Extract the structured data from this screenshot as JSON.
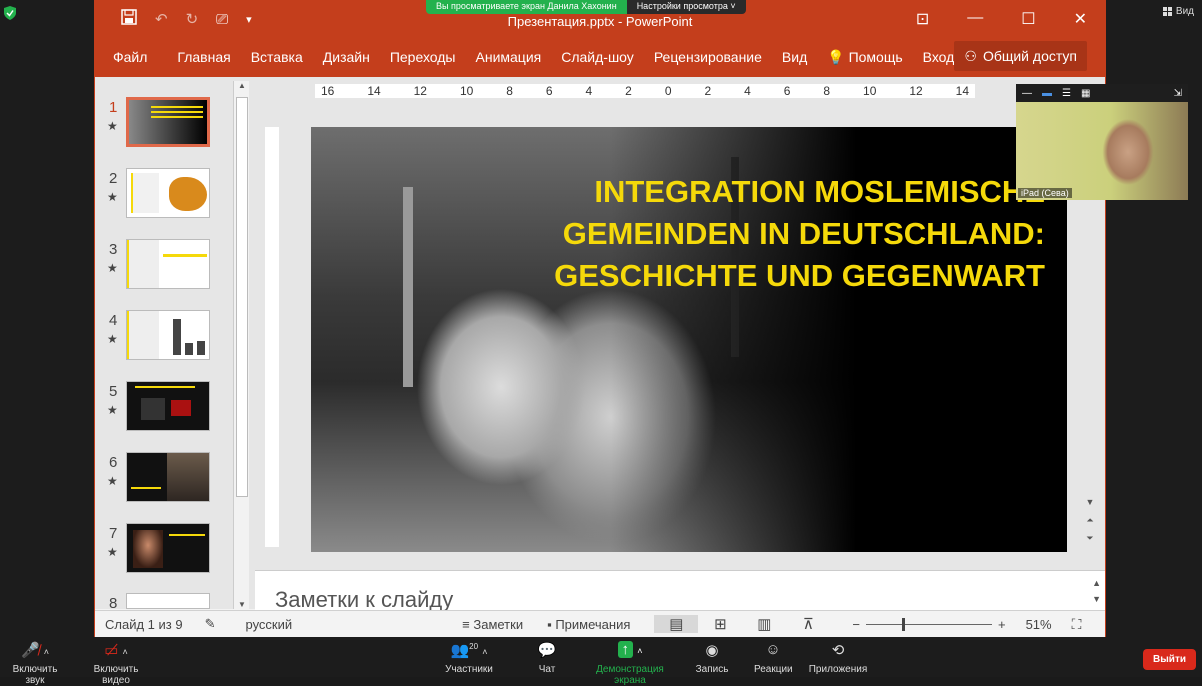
{
  "share_banner": {
    "viewing_text": "Вы просматриваете экран Данила Хахонин",
    "view_options": "Настройки просмотра"
  },
  "zoom_top": {
    "view_label": "Вид"
  },
  "ppt": {
    "title": "Презентация.pptx - PowerPoint",
    "menu": {
      "file": "Файл",
      "tabs": [
        "Главная",
        "Вставка",
        "Дизайн",
        "Переходы",
        "Анимация",
        "Слайд-шоу",
        "Рецензирование",
        "Вид",
        "Помощь",
        "Вход"
      ],
      "share": "Общий доступ"
    },
    "ruler_h": [
      "16",
      "14",
      "12",
      "10",
      "8",
      "6",
      "4",
      "2",
      "0",
      "2",
      "4",
      "6",
      "8",
      "10",
      "12",
      "14"
    ],
    "thumbnails": [
      {
        "num": "1",
        "star": "★",
        "active": true
      },
      {
        "num": "2",
        "star": "★"
      },
      {
        "num": "3",
        "star": "★"
      },
      {
        "num": "4",
        "star": "★"
      },
      {
        "num": "5",
        "star": "★"
      },
      {
        "num": "6",
        "star": "★"
      },
      {
        "num": "7",
        "star": "★"
      },
      {
        "num": "8",
        "star": ""
      }
    ],
    "slide": {
      "title_line1": "INTEGRATION MOSLEMISCHE",
      "title_line2": "GEMEINDEN IN DEUTSCHLAND:",
      "title_line3": "GESCHICHTE UND GEGENWART"
    },
    "notes_placeholder": "Заметки к слайду",
    "status": {
      "slide_counter": "Слайд 1 из 9",
      "language": "русский",
      "notes": "Заметки",
      "comments": "Примечания",
      "zoom": "51%"
    }
  },
  "webcam": {
    "name": "iPad (Сева)"
  },
  "zoom_toolbar": {
    "mute": "Включить звук",
    "video": "Включить видео",
    "participants": "Участники",
    "participants_count": "20",
    "chat": "Чат",
    "share_screen": "Демонстрация экрана",
    "record": "Запись",
    "reactions": "Реакции",
    "apps": "Приложения",
    "leave": "Выйти"
  },
  "colors": {
    "ppt_accent": "#c43e1c",
    "slide_title": "#f5d90a",
    "zoom_green": "#23b14d",
    "leave_red": "#d9291b"
  }
}
